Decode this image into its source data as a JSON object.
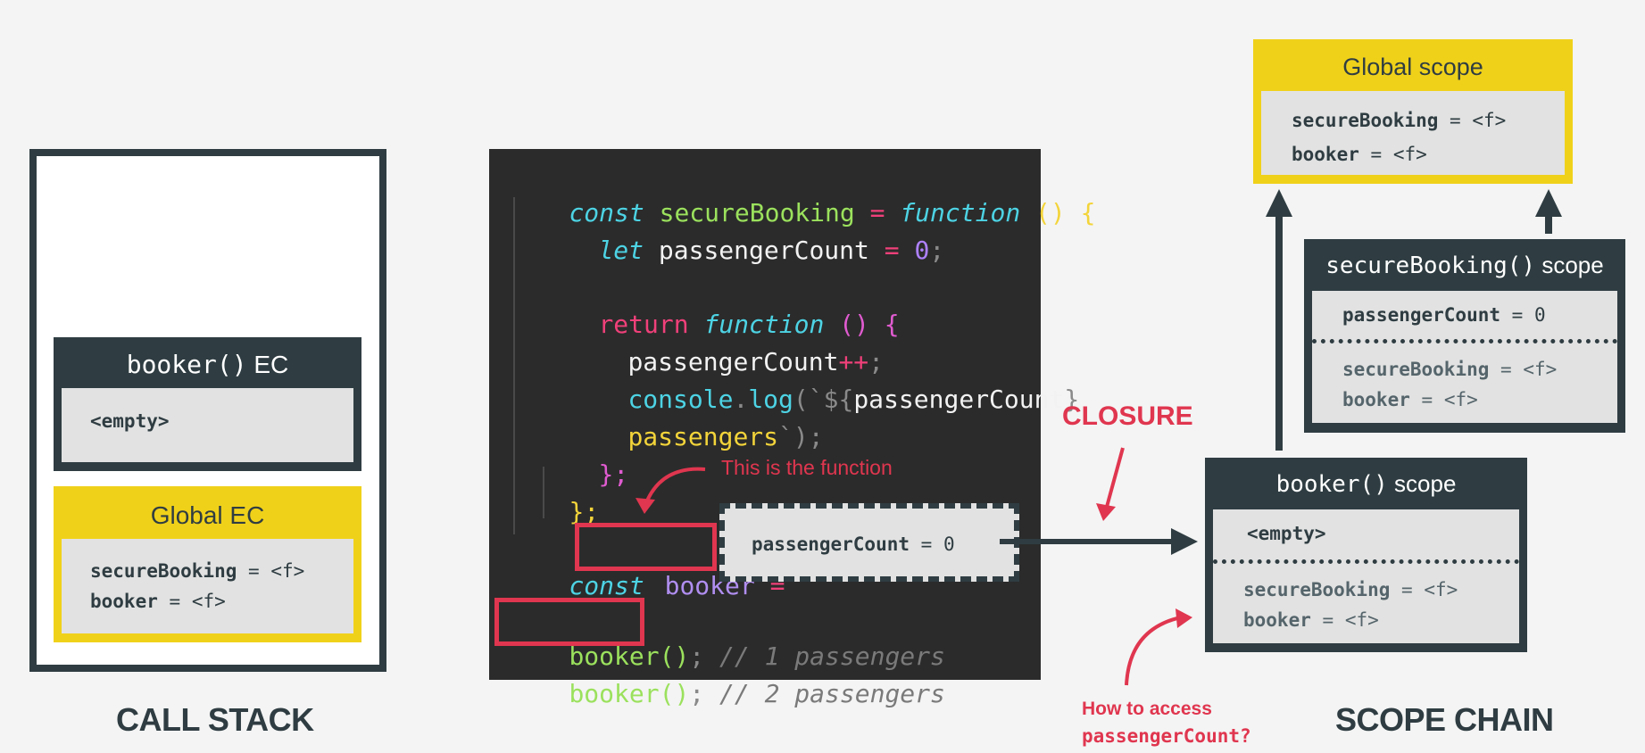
{
  "call_stack": {
    "label": "CALL STACK",
    "booker_ec": {
      "name": "booker()",
      "suffix": "EC",
      "content": "<empty>"
    },
    "global_ec": {
      "title": "Global EC",
      "vars": [
        {
          "name": "secureBooking",
          "op": "=",
          "value": "<f>"
        },
        {
          "name": "booker",
          "op": "=",
          "value": "<f>"
        }
      ]
    }
  },
  "code": {
    "l1": {
      "kw": "const",
      "name": "secureBooking",
      "eq": "=",
      "fkw": "function",
      "paren": "()",
      "brace": "{"
    },
    "l2": {
      "kw": "let",
      "name": "passengerCount",
      "eq": "=",
      "num": "0",
      "semi": ";"
    },
    "l4": {
      "ret": "return",
      "fkw": "function",
      "paren": "()",
      "brace": "{"
    },
    "l5": {
      "name": "passengerCount",
      "op": "++",
      "semi": ";"
    },
    "l6": {
      "obj": "console",
      "dot": ".",
      "method": "log",
      "open": "(`${",
      "var": "passengerCount",
      "close": "}"
    },
    "l7": {
      "text": "passengers",
      "end": "`);"
    },
    "l8": {
      "close": "};"
    },
    "l9": {
      "close": "};"
    },
    "l11": {
      "kw": "const",
      "name": "booker",
      "eq": "="
    },
    "l12": {
      "call": "booker()",
      "semi": ";",
      "comment": "// 1 passengers"
    },
    "l13": {
      "call": "booker()",
      "semi": ";",
      "comment": "// 2 passengers"
    }
  },
  "annotations": {
    "this_is_function": "This is the function",
    "closure": "CLOSURE",
    "how_to_access_1": "How to access",
    "how_to_access_2": "passengerCount?",
    "closure_box": {
      "name": "passengerCount",
      "op": "=",
      "value": "0"
    }
  },
  "scope_chain": {
    "label": "SCOPE CHAIN",
    "global": {
      "title": "Global scope",
      "vars": [
        {
          "name": "secureBooking",
          "op": "=",
          "value": "<f>"
        },
        {
          "name": "booker",
          "op": "=",
          "value": "<f>"
        }
      ]
    },
    "secure": {
      "name": "secureBooking()",
      "suffix": "scope",
      "own": {
        "name": "passengerCount",
        "op": "=",
        "value": "0"
      },
      "vars": [
        {
          "name": "secureBooking",
          "op": "=",
          "value": "<f>"
        },
        {
          "name": "booker",
          "op": "=",
          "value": "<f>"
        }
      ]
    },
    "booker": {
      "name": "booker()",
      "suffix": "scope",
      "own": "<empty>",
      "vars": [
        {
          "name": "secureBooking",
          "op": "=",
          "value": "<f>"
        },
        {
          "name": "booker",
          "op": "=",
          "value": "<f>"
        }
      ]
    }
  },
  "colors": {
    "dark": "#2f3d42",
    "yellow": "#f0d11a",
    "red": "#e0364f",
    "code_bg": "#2b2b2b"
  }
}
